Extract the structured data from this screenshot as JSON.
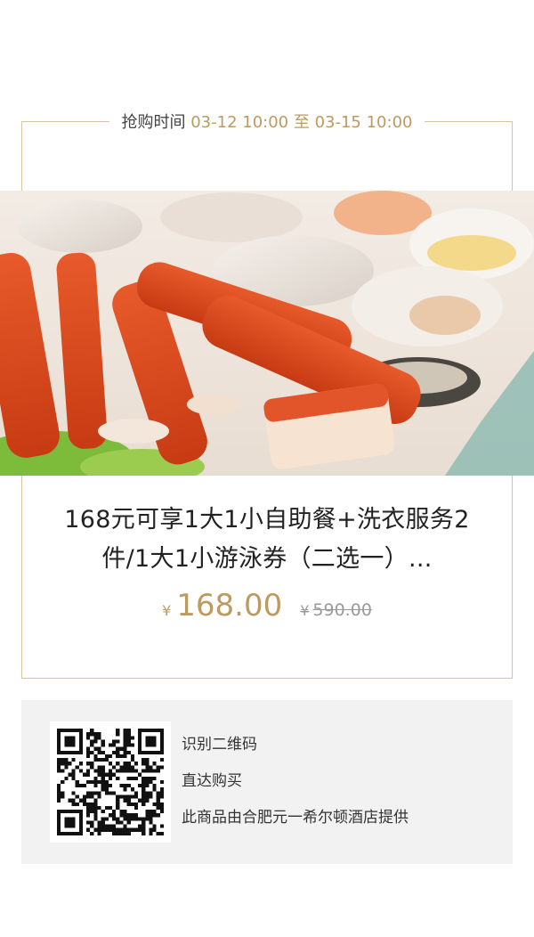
{
  "sale_time": {
    "label": "抢购时间",
    "range": "03-12 10:00 至 03-15 10:00"
  },
  "product": {
    "image_alt": "帝王蟹海鲜自助餐",
    "title": "168元可享1大1小自助餐+洗衣服务2件/1大1小游泳券（二选一）...",
    "currency": "¥",
    "price": "168.00",
    "original_price": "590.00"
  },
  "qr": {
    "line1": "识别二维码",
    "line2": "直达购买",
    "provider": "此商品由合肥元一希尔顿酒店提供"
  },
  "colors": {
    "accent_gold": "#bd9a5f",
    "frame_border": "#d8c4a0",
    "card_bg": "#f2f2f2"
  }
}
